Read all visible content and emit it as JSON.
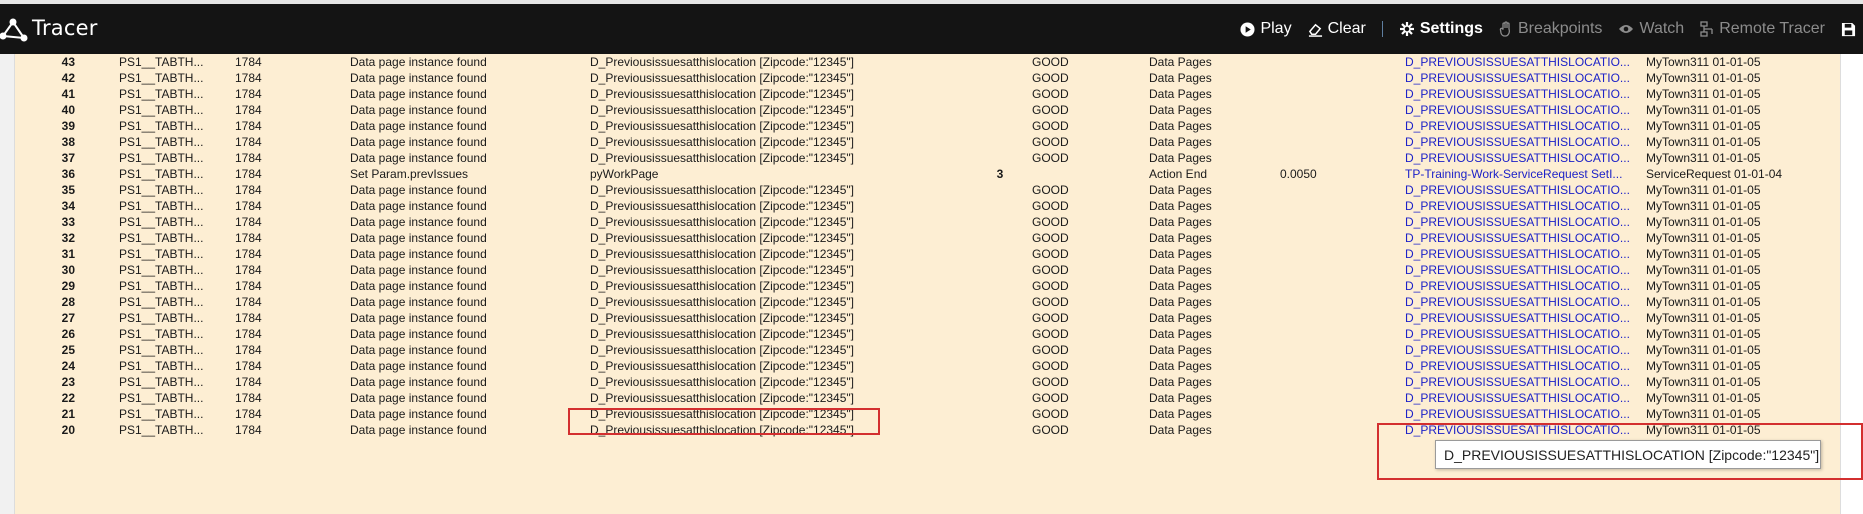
{
  "app": {
    "title": "Tracer",
    "colors": {
      "header_bg": "#141414",
      "row_bg": "#fdeed3",
      "link": "#1d22c8",
      "highlight": "#d32f2f"
    }
  },
  "toolbar": {
    "play": {
      "label": "Play",
      "icon": "play-circle-icon"
    },
    "clear": {
      "label": "Clear",
      "icon": "eraser-icon"
    },
    "settings": {
      "label": "Settings",
      "icon": "gear-icon"
    },
    "breakpoints": {
      "label": "Breakpoints",
      "icon": "hand-icon"
    },
    "watch": {
      "label": "Watch",
      "icon": "eye-icon"
    },
    "remote_tracer": {
      "label": "Remote Tracer",
      "icon": "network-icon"
    },
    "save_icon": "save-icon"
  },
  "rows": [
    {
      "num": "43",
      "thread": "PS1__TABTH...",
      "interaction": "1784",
      "event": "Data page instance found",
      "step": "D_Previousissuesatthislocation [Zipcode:\"12345\"]",
      "depth": "",
      "status": "GOOD",
      "type": "Data Pages",
      "elapsed": "",
      "rule": "D_PREVIOUSISSUESATTHISLOCATIO...",
      "ruleset": "MyTown311 01-01-05"
    },
    {
      "num": "42",
      "thread": "PS1__TABTH...",
      "interaction": "1784",
      "event": "Data page instance found",
      "step": "D_Previousissuesatthislocation [Zipcode:\"12345\"]",
      "depth": "",
      "status": "GOOD",
      "type": "Data Pages",
      "elapsed": "",
      "rule": "D_PREVIOUSISSUESATTHISLOCATIO...",
      "ruleset": "MyTown311 01-01-05"
    },
    {
      "num": "41",
      "thread": "PS1__TABTH...",
      "interaction": "1784",
      "event": "Data page instance found",
      "step": "D_Previousissuesatthislocation [Zipcode:\"12345\"]",
      "depth": "",
      "status": "GOOD",
      "type": "Data Pages",
      "elapsed": "",
      "rule": "D_PREVIOUSISSUESATTHISLOCATIO...",
      "ruleset": "MyTown311 01-01-05"
    },
    {
      "num": "40",
      "thread": "PS1__TABTH...",
      "interaction": "1784",
      "event": "Data page instance found",
      "step": "D_Previousissuesatthislocation [Zipcode:\"12345\"]",
      "depth": "",
      "status": "GOOD",
      "type": "Data Pages",
      "elapsed": "",
      "rule": "D_PREVIOUSISSUESATTHISLOCATIO...",
      "ruleset": "MyTown311 01-01-05"
    },
    {
      "num": "39",
      "thread": "PS1__TABTH...",
      "interaction": "1784",
      "event": "Data page instance found",
      "step": "D_Previousissuesatthislocation [Zipcode:\"12345\"]",
      "depth": "",
      "status": "GOOD",
      "type": "Data Pages",
      "elapsed": "",
      "rule": "D_PREVIOUSISSUESATTHISLOCATIO...",
      "ruleset": "MyTown311 01-01-05"
    },
    {
      "num": "38",
      "thread": "PS1__TABTH...",
      "interaction": "1784",
      "event": "Data page instance found",
      "step": "D_Previousissuesatthislocation [Zipcode:\"12345\"]",
      "depth": "",
      "status": "GOOD",
      "type": "Data Pages",
      "elapsed": "",
      "rule": "D_PREVIOUSISSUESATTHISLOCATIO...",
      "ruleset": "MyTown311 01-01-05"
    },
    {
      "num": "37",
      "thread": "PS1__TABTH...",
      "interaction": "1784",
      "event": "Data page instance found",
      "step": "D_Previousissuesatthislocation [Zipcode:\"12345\"]",
      "depth": "",
      "status": "GOOD",
      "type": "Data Pages",
      "elapsed": "",
      "rule": "D_PREVIOUSISSUESATTHISLOCATIO...",
      "ruleset": "MyTown311 01-01-05"
    },
    {
      "num": "36",
      "thread": "PS1__TABTH...",
      "interaction": "1784",
      "event": "Set Param.prevIssues",
      "step": "pyWorkPage",
      "depth": "3",
      "status": "",
      "type": "Action End",
      "elapsed": "0.0050",
      "rule": "TP-Training-Work-ServiceRequest SetI...",
      "ruleset": "ServiceRequest 01-01-04"
    },
    {
      "num": "35",
      "thread": "PS1__TABTH...",
      "interaction": "1784",
      "event": "Data page instance found",
      "step": "D_Previousissuesatthislocation [Zipcode:\"12345\"]",
      "depth": "",
      "status": "GOOD",
      "type": "Data Pages",
      "elapsed": "",
      "rule": "D_PREVIOUSISSUESATTHISLOCATIO...",
      "ruleset": "MyTown311 01-01-05"
    },
    {
      "num": "34",
      "thread": "PS1__TABTH...",
      "interaction": "1784",
      "event": "Data page instance found",
      "step": "D_Previousissuesatthislocation [Zipcode:\"12345\"]",
      "depth": "",
      "status": "GOOD",
      "type": "Data Pages",
      "elapsed": "",
      "rule": "D_PREVIOUSISSUESATTHISLOCATIO...",
      "ruleset": "MyTown311 01-01-05"
    },
    {
      "num": "33",
      "thread": "PS1__TABTH...",
      "interaction": "1784",
      "event": "Data page instance found",
      "step": "D_Previousissuesatthislocation [Zipcode:\"12345\"]",
      "depth": "",
      "status": "GOOD",
      "type": "Data Pages",
      "elapsed": "",
      "rule": "D_PREVIOUSISSUESATTHISLOCATIO...",
      "ruleset": "MyTown311 01-01-05"
    },
    {
      "num": "32",
      "thread": "PS1__TABTH...",
      "interaction": "1784",
      "event": "Data page instance found",
      "step": "D_Previousissuesatthislocation [Zipcode:\"12345\"]",
      "depth": "",
      "status": "GOOD",
      "type": "Data Pages",
      "elapsed": "",
      "rule": "D_PREVIOUSISSUESATTHISLOCATIO...",
      "ruleset": "MyTown311 01-01-05"
    },
    {
      "num": "31",
      "thread": "PS1__TABTH...",
      "interaction": "1784",
      "event": "Data page instance found",
      "step": "D_Previousissuesatthislocation [Zipcode:\"12345\"]",
      "depth": "",
      "status": "GOOD",
      "type": "Data Pages",
      "elapsed": "",
      "rule": "D_PREVIOUSISSUESATTHISLOCATIO...",
      "ruleset": "MyTown311 01-01-05"
    },
    {
      "num": "30",
      "thread": "PS1__TABTH...",
      "interaction": "1784",
      "event": "Data page instance found",
      "step": "D_Previousissuesatthislocation [Zipcode:\"12345\"]",
      "depth": "",
      "status": "GOOD",
      "type": "Data Pages",
      "elapsed": "",
      "rule": "D_PREVIOUSISSUESATTHISLOCATIO...",
      "ruleset": "MyTown311 01-01-05"
    },
    {
      "num": "29",
      "thread": "PS1__TABTH...",
      "interaction": "1784",
      "event": "Data page instance found",
      "step": "D_Previousissuesatthislocation [Zipcode:\"12345\"]",
      "depth": "",
      "status": "GOOD",
      "type": "Data Pages",
      "elapsed": "",
      "rule": "D_PREVIOUSISSUESATTHISLOCATIO...",
      "ruleset": "MyTown311 01-01-05"
    },
    {
      "num": "28",
      "thread": "PS1__TABTH...",
      "interaction": "1784",
      "event": "Data page instance found",
      "step": "D_Previousissuesatthislocation [Zipcode:\"12345\"]",
      "depth": "",
      "status": "GOOD",
      "type": "Data Pages",
      "elapsed": "",
      "rule": "D_PREVIOUSISSUESATTHISLOCATIO...",
      "ruleset": "MyTown311 01-01-05"
    },
    {
      "num": "27",
      "thread": "PS1__TABTH...",
      "interaction": "1784",
      "event": "Data page instance found",
      "step": "D_Previousissuesatthislocation [Zipcode:\"12345\"]",
      "depth": "",
      "status": "GOOD",
      "type": "Data Pages",
      "elapsed": "",
      "rule": "D_PREVIOUSISSUESATTHISLOCATIO...",
      "ruleset": "MyTown311 01-01-05"
    },
    {
      "num": "26",
      "thread": "PS1__TABTH...",
      "interaction": "1784",
      "event": "Data page instance found",
      "step": "D_Previousissuesatthislocation [Zipcode:\"12345\"]",
      "depth": "",
      "status": "GOOD",
      "type": "Data Pages",
      "elapsed": "",
      "rule": "D_PREVIOUSISSUESATTHISLOCATIO...",
      "ruleset": "MyTown311 01-01-05"
    },
    {
      "num": "25",
      "thread": "PS1__TABTH...",
      "interaction": "1784",
      "event": "Data page instance found",
      "step": "D_Previousissuesatthislocation [Zipcode:\"12345\"]",
      "depth": "",
      "status": "GOOD",
      "type": "Data Pages",
      "elapsed": "",
      "rule": "D_PREVIOUSISSUESATTHISLOCATIO...",
      "ruleset": "MyTown311 01-01-05"
    },
    {
      "num": "24",
      "thread": "PS1__TABTH...",
      "interaction": "1784",
      "event": "Data page instance found",
      "step": "D_Previousissuesatthislocation [Zipcode:\"12345\"]",
      "depth": "",
      "status": "GOOD",
      "type": "Data Pages",
      "elapsed": "",
      "rule": "D_PREVIOUSISSUESATTHISLOCATIO...",
      "ruleset": "MyTown311 01-01-05"
    },
    {
      "num": "23",
      "thread": "PS1__TABTH...",
      "interaction": "1784",
      "event": "Data page instance found",
      "step": "D_Previousissuesatthislocation [Zipcode:\"12345\"]",
      "depth": "",
      "status": "GOOD",
      "type": "Data Pages",
      "elapsed": "",
      "rule": "D_PREVIOUSISSUESATTHISLOCATIO...",
      "ruleset": "MyTown311 01-01-05"
    },
    {
      "num": "22",
      "thread": "PS1__TABTH...",
      "interaction": "1784",
      "event": "Data page instance found",
      "step": "D_Previousissuesatthislocation [Zipcode:\"12345\"]",
      "depth": "",
      "status": "GOOD",
      "type": "Data Pages",
      "elapsed": "",
      "rule": "D_PREVIOUSISSUESATTHISLOCATIO...",
      "ruleset": "MyTown311 01-01-05"
    },
    {
      "num": "21",
      "thread": "PS1__TABTH...",
      "interaction": "1784",
      "event": "Data page instance found",
      "step": "D_Previousissuesatthislocation [Zipcode:\"12345\"]",
      "depth": "",
      "status": "GOOD",
      "type": "Data Pages",
      "elapsed": "",
      "rule": "D_PREVIOUSISSUESATTHISLOCATIO...",
      "ruleset": "MyTown311 01-01-05"
    },
    {
      "num": "20",
      "thread": "PS1__TABTH...",
      "interaction": "1784",
      "event": "Data page instance found",
      "step": "D_Previousissuesatthislocation [Zipcode:\"12345\"]",
      "depth": "",
      "status": "GOOD",
      "type": "Data Pages",
      "elapsed": "",
      "rule": "D_PREVIOUSISSUESATTHISLOCATIO...",
      "ruleset": "MyTown311 01-01-05"
    }
  ],
  "tooltip": {
    "text": "D_PREVIOUSISSUESATTHISLOCATION [Zipcode:\"12345\"]"
  }
}
